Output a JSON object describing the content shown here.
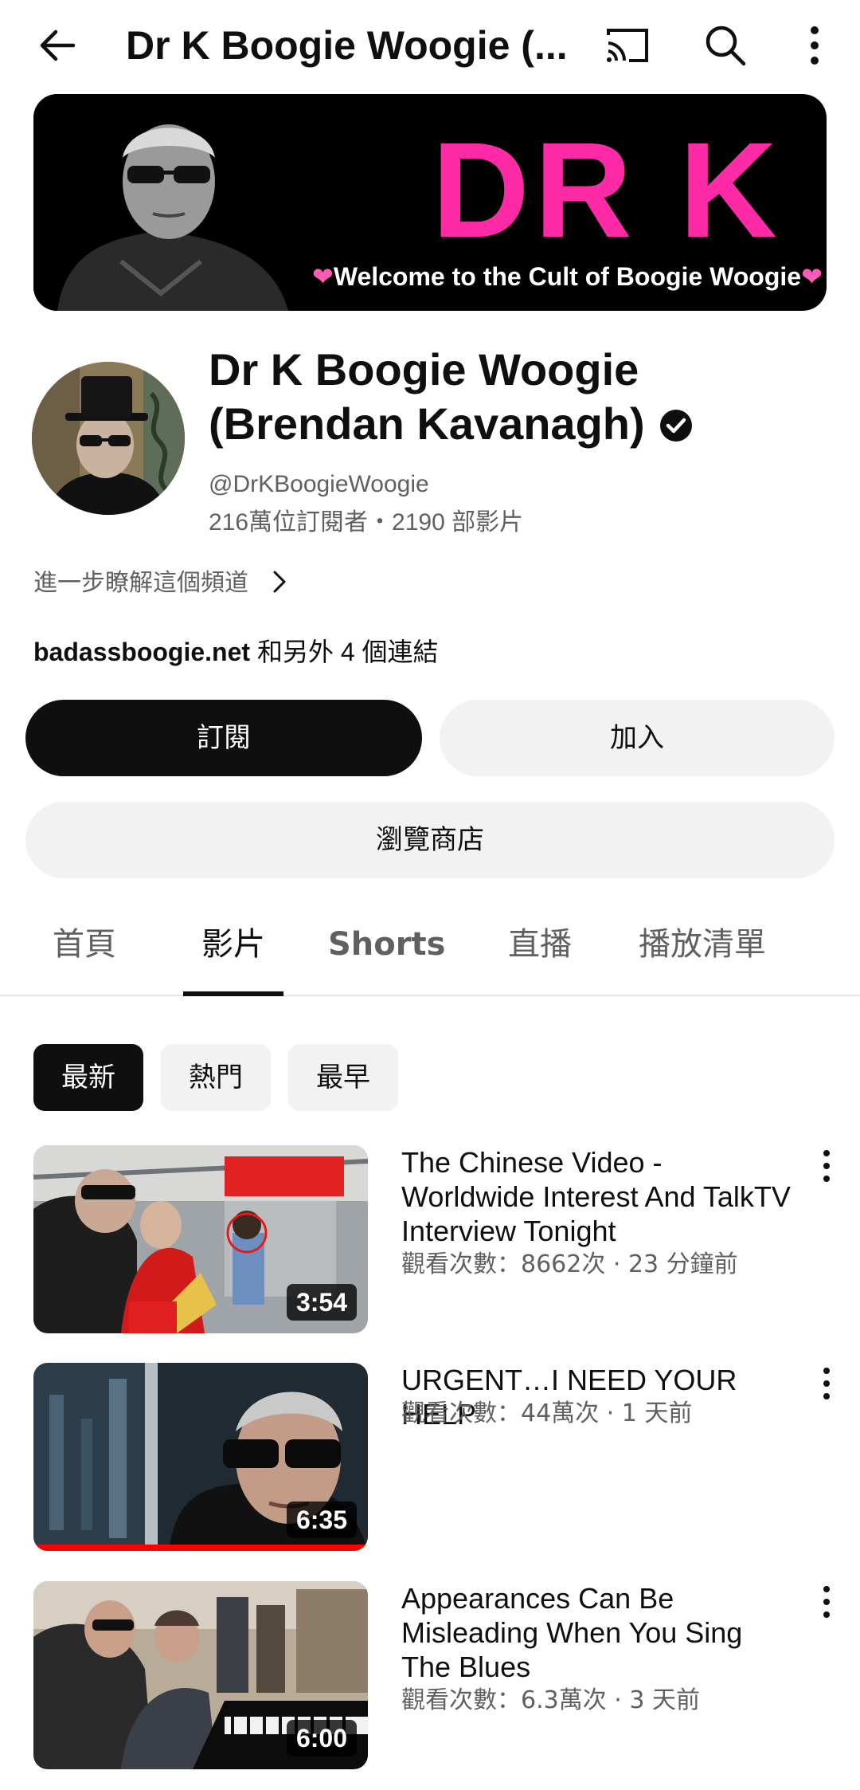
{
  "topbar": {
    "title": "Dr K Boogie Woogie (...",
    "icons": [
      "back-arrow-icon",
      "cast-icon",
      "search-icon",
      "more-vert-icon"
    ]
  },
  "banner": {
    "headline": "DR K",
    "tagline": "Welcome to the Cult of Boogie Woogie",
    "heart": "❤"
  },
  "channel": {
    "name_line1": "Dr K Boogie Woogie",
    "name_line2": "(Brendan Kavanagh)",
    "handle": "@DrKBoogieWoogie",
    "stats": "216萬位訂閱者・2190 部影片",
    "learn_more": "進一步瞭解這個頻道",
    "link_main": "badassboogie.net",
    "link_rest": " 和另外 4 個連結"
  },
  "buttons": {
    "subscribe": "訂閱",
    "join": "加入",
    "store": "瀏覽商店"
  },
  "tabs": [
    {
      "label": "首頁",
      "active": false
    },
    {
      "label": "影片",
      "active": true
    },
    {
      "label": "Shorts",
      "active": false
    },
    {
      "label": "直播",
      "active": false
    },
    {
      "label": "播放清單",
      "active": false
    }
  ],
  "filters": [
    {
      "label": "最新",
      "selected": true
    },
    {
      "label": "熱門",
      "selected": false
    },
    {
      "label": "最早",
      "selected": false
    }
  ],
  "videos": [
    {
      "title": "The Chinese Video - Worldwide Interest And TalkTV Interview Tonight",
      "meta": "觀看次數：8662次 · 23 分鐘前",
      "duration": "3:54",
      "watched": 0
    },
    {
      "title": "URGENT…I NEED YOUR HELP",
      "meta": "觀看次數：44萬次 · 1 天前",
      "duration": "6:35",
      "watched": 1
    },
    {
      "title": "Appearances Can Be Misleading When You Sing The Blues",
      "meta": "觀看次數：6.3萬次 · 3 天前",
      "duration": "6:00",
      "watched": 0
    }
  ],
  "colors": {
    "brand_pink": "#ff2ba6",
    "text_primary": "#0f0f0f",
    "text_secondary": "#606060",
    "chip_bg": "#f2f2f2",
    "progress_red": "#ff0000"
  }
}
